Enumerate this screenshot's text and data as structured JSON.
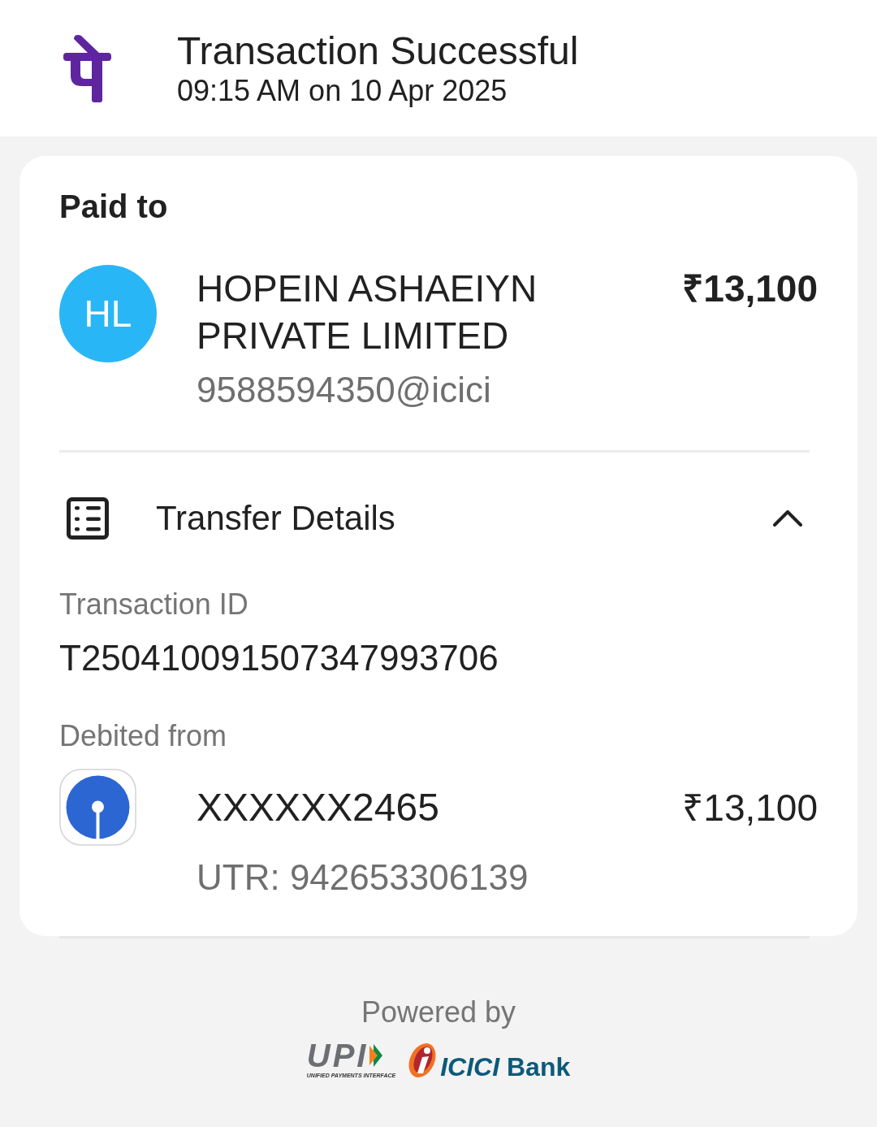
{
  "header": {
    "title": "Transaction Successful",
    "subtitle": "09:15 AM on 10 Apr 2025"
  },
  "paid_to": {
    "heading": "Paid to",
    "avatar_initials": "HL",
    "name": "HOPEIN ASHAEIYN PRIVATE LIMITED",
    "amount": "₹13,100",
    "upi_id": "9588594350@icici"
  },
  "transfer_details": {
    "title": "Transfer Details",
    "expanded": true,
    "transaction_id_label": "Transaction ID",
    "transaction_id": "T250410091507347993706",
    "debited_from_label": "Debited from",
    "account": "XXXXXX2465",
    "amount": "₹13,100",
    "utr": "UTR: 942653306139"
  },
  "footer": {
    "powered_by": "Powered by",
    "upi_wordmark": "UPI",
    "upi_tagline": "UNIFIED PAYMENTS INTERFACE",
    "bank_wordmark": "*ICICI* Bank"
  }
}
